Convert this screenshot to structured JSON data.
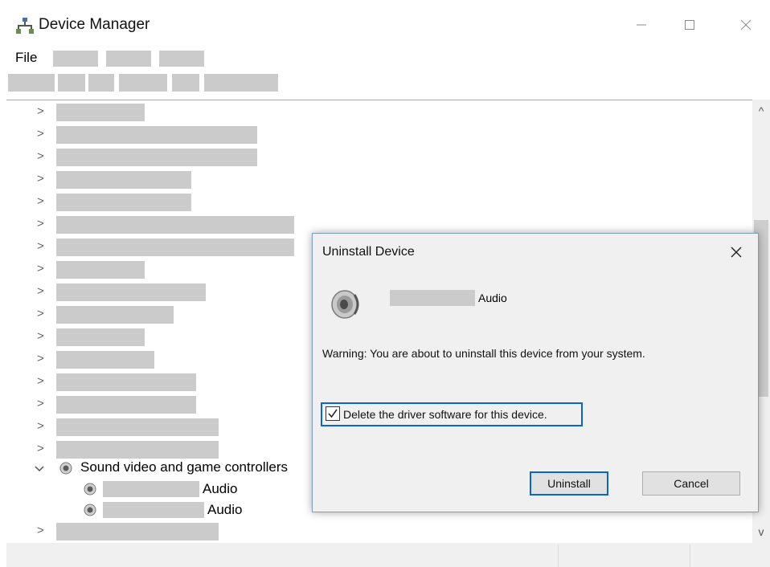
{
  "window": {
    "title": "Device Manager",
    "icons": {
      "app": "device-manager-icon",
      "minimize": "minimize-icon",
      "maximize": "maximize-icon",
      "close": "close-icon"
    }
  },
  "menu": {
    "file_label": "File"
  },
  "tree": {
    "expand_glyph": ">",
    "sound_category": {
      "label": "Sound video and game controllers",
      "children": [
        {
          "label": "Audio"
        },
        {
          "label": "Audio"
        }
      ]
    }
  },
  "scrollbar": {
    "up": "^",
    "down": "v"
  },
  "dialog": {
    "title": "Uninstall Device",
    "device_label": "Audio",
    "warning": "Warning: You are about to uninstall this device from your system.",
    "checkbox_label": "Delete the driver software for this device.",
    "checkbox_checked": true,
    "uninstall_label": "Uninstall",
    "cancel_label": "Cancel",
    "close_glyph": "X"
  }
}
